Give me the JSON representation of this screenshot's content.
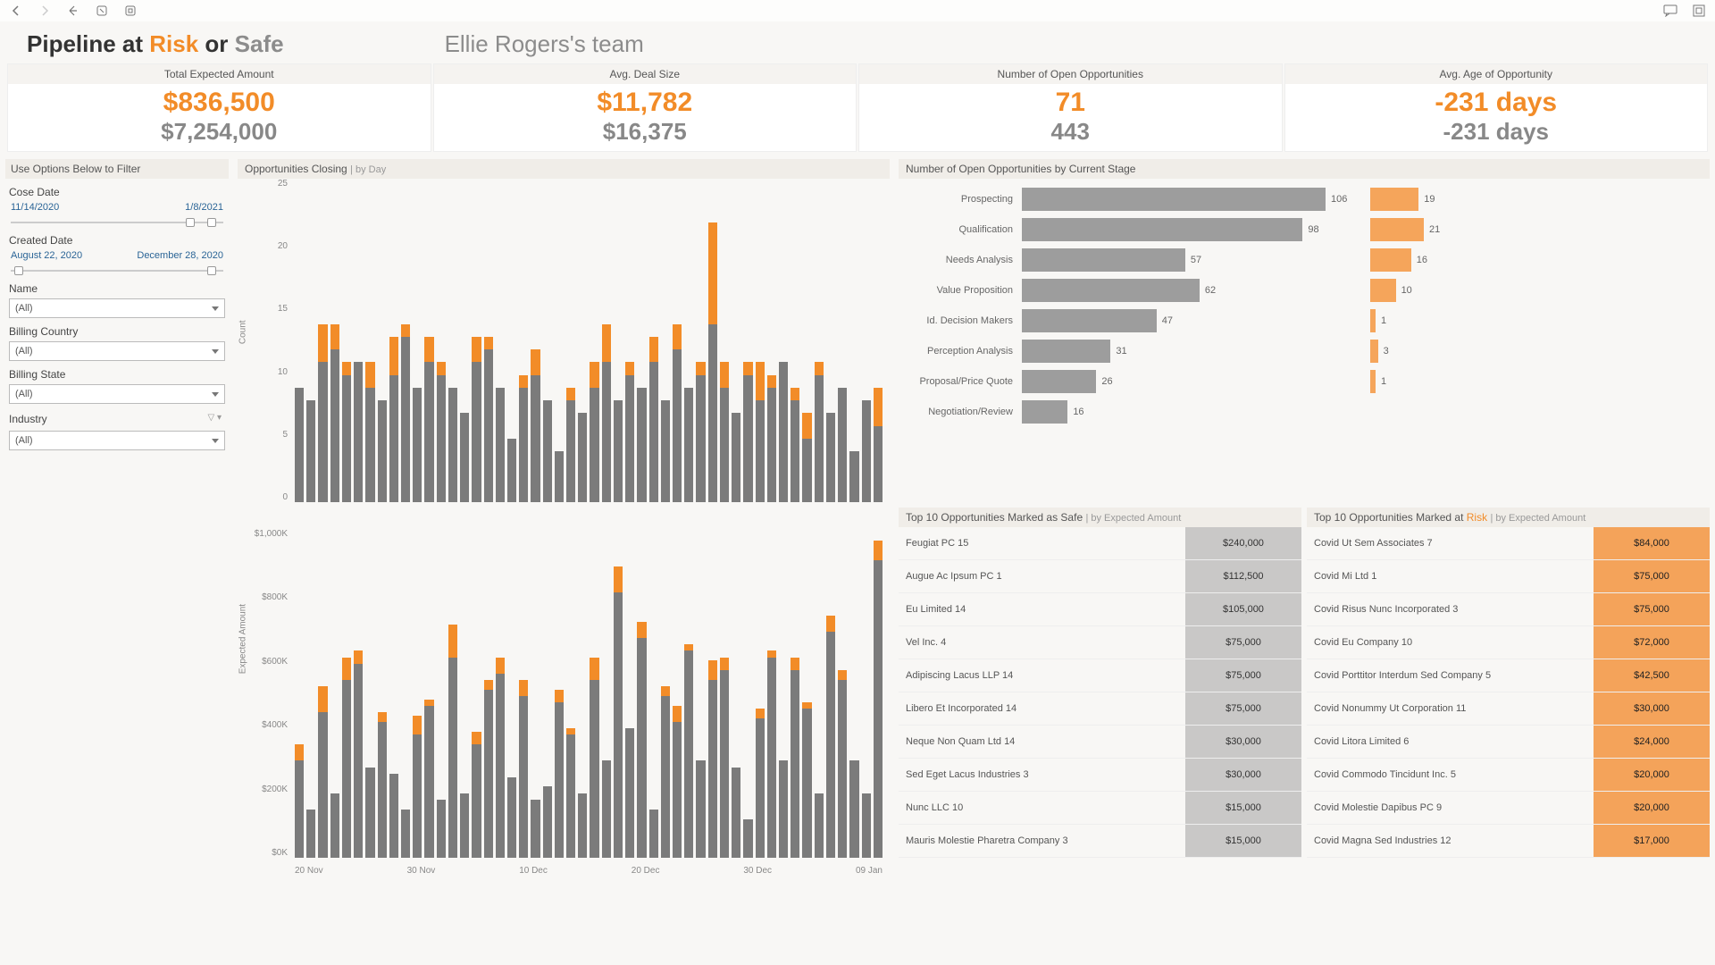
{
  "title": {
    "prefix": "Pipeline at ",
    "risk": "Risk",
    "mid": " or ",
    "safe": "Safe",
    "team": "Ellie Rogers's team"
  },
  "kpis": [
    {
      "label": "Total Expected Amount",
      "v1": "$836,500",
      "v2": "$7,254,000"
    },
    {
      "label": "Avg. Deal Size",
      "v1": "$11,782",
      "v2": "$16,375"
    },
    {
      "label": "Number of Open Opportunities",
      "v1": "71",
      "v2": "443"
    },
    {
      "label": "Avg. Age of Opportunity",
      "v1": "-231 days",
      "v2": "-231 days"
    }
  ],
  "filters": {
    "header": "Use Options Below to Filter",
    "closeDate": {
      "label": "Cose Date",
      "from": "11/14/2020",
      "to": "1/8/2021"
    },
    "createdDate": {
      "label": "Created Date",
      "from": "August 22, 2020",
      "to": "December 28, 2020"
    },
    "name": {
      "label": "Name",
      "value": "(All)"
    },
    "billingCountry": {
      "label": "Billing Country",
      "value": "(All)"
    },
    "billingState": {
      "label": "Billing State",
      "value": "(All)"
    },
    "industry": {
      "label": "Industry",
      "value": "(All)"
    }
  },
  "chart1": {
    "title": "Opportunities Closing ",
    "sub": "| by Day",
    "ylabel": "Count"
  },
  "chart2": {
    "ylabel": "Expected Amount"
  },
  "stages": {
    "title": "Number of Open Opportunities by Current Stage"
  },
  "safeTable": {
    "title": "Top 10 Opportunities Marked as Safe ",
    "sub": "| by Expected Amount"
  },
  "riskTable": {
    "titlePre": "Top 10 Opportunities Marked at ",
    "titleRisk": "Risk ",
    "sub": "| by Expected Amount"
  },
  "chart_data": [
    {
      "type": "bar",
      "title": "Opportunities Closing by Day (Count)",
      "ylabel": "Count",
      "ylim": [
        0,
        25
      ],
      "yticks": [
        0,
        5,
        10,
        15,
        20,
        25
      ],
      "x_ticks": [
        "20 Nov",
        "30 Nov",
        "10 Dec",
        "20 Dec",
        "30 Dec",
        "09 Jan"
      ],
      "series": [
        {
          "name": "Safe",
          "color": "#7b7b7b",
          "values": [
            9,
            8,
            11,
            12,
            10,
            11,
            9,
            8,
            10,
            13,
            9,
            11,
            10,
            9,
            7,
            11,
            12,
            9,
            5,
            9,
            10,
            8,
            4,
            8,
            7,
            9,
            11,
            8,
            10,
            9,
            11,
            8,
            12,
            9,
            10,
            14,
            9,
            7,
            10,
            8,
            9,
            11,
            8,
            5,
            10,
            7,
            9,
            4,
            8,
            6
          ]
        },
        {
          "name": "Risk",
          "color": "#f28c28",
          "values": [
            0,
            0,
            3,
            2,
            1,
            0,
            2,
            0,
            3,
            1,
            0,
            2,
            1,
            0,
            0,
            2,
            1,
            0,
            0,
            1,
            2,
            0,
            0,
            1,
            0,
            2,
            3,
            0,
            1,
            0,
            2,
            0,
            2,
            0,
            1,
            8,
            2,
            0,
            1,
            3,
            1,
            0,
            1,
            2,
            1,
            0,
            0,
            0,
            0,
            3
          ]
        }
      ]
    },
    {
      "type": "bar",
      "title": "Opportunities Closing by Day (Expected Amount $K)",
      "ylabel": "Expected Amount",
      "ylim": [
        0,
        1000
      ],
      "yticks": [
        "$0K",
        "$200K",
        "$400K",
        "$600K",
        "$800K",
        "$1,000K"
      ],
      "x_ticks": [
        "20 Nov",
        "30 Nov",
        "10 Dec",
        "20 Dec",
        "30 Dec",
        "09 Jan"
      ],
      "series": [
        {
          "name": "Safe",
          "color": "#7b7b7b",
          "values": [
            300,
            150,
            450,
            200,
            550,
            600,
            280,
            420,
            260,
            150,
            380,
            470,
            180,
            620,
            200,
            350,
            520,
            570,
            250,
            500,
            180,
            220,
            480,
            380,
            200,
            550,
            300,
            820,
            400,
            680,
            150,
            500,
            420,
            640,
            300,
            550,
            580,
            280,
            120,
            430,
            620,
            300,
            580,
            460,
            200,
            700,
            550,
            300,
            200,
            920
          ]
        },
        {
          "name": "Risk",
          "color": "#f28c28",
          "values": [
            50,
            0,
            80,
            0,
            70,
            40,
            0,
            30,
            0,
            0,
            60,
            20,
            0,
            100,
            0,
            40,
            30,
            50,
            0,
            50,
            0,
            0,
            40,
            20,
            0,
            70,
            0,
            80,
            0,
            50,
            0,
            30,
            50,
            20,
            0,
            60,
            40,
            0,
            0,
            30,
            20,
            0,
            40,
            20,
            0,
            50,
            30,
            0,
            0,
            60
          ]
        }
      ]
    },
    {
      "type": "bar",
      "title": "Number of Open Opportunities by Current Stage",
      "orientation": "horizontal",
      "categories": [
        "Prospecting",
        "Qualification",
        "Needs Analysis",
        "Value Proposition",
        "Id. Decision Makers",
        "Perception Analysis",
        "Proposal/Price Quote",
        "Negotiation/Review"
      ],
      "series": [
        {
          "name": "Safe",
          "color": "#9d9d9d",
          "values": [
            106,
            98,
            57,
            62,
            47,
            31,
            26,
            16
          ]
        },
        {
          "name": "Risk",
          "color": "#f5a55b",
          "values": [
            19,
            21,
            16,
            10,
            1,
            3,
            1,
            0
          ]
        }
      ]
    },
    {
      "type": "table",
      "title": "Top 10 Opportunities Marked as Safe",
      "columns": [
        "Name",
        "Expected Amount"
      ],
      "rows": [
        [
          "Feugiat PC 15",
          "$240,000"
        ],
        [
          "Augue Ac Ipsum PC 1",
          "$112,500"
        ],
        [
          "Eu Limited 14",
          "$105,000"
        ],
        [
          "Vel Inc. 4",
          "$75,000"
        ],
        [
          "Adipiscing Lacus LLP 14",
          "$75,000"
        ],
        [
          "Libero Et Incorporated 14",
          "$75,000"
        ],
        [
          "Neque Non Quam Ltd 14",
          "$30,000"
        ],
        [
          "Sed Eget Lacus Industries 3",
          "$30,000"
        ],
        [
          "Nunc LLC 10",
          "$15,000"
        ],
        [
          "Mauris Molestie Pharetra Company 3",
          "$15,000"
        ]
      ]
    },
    {
      "type": "table",
      "title": "Top 10 Opportunities Marked at Risk",
      "columns": [
        "Name",
        "Expected Amount"
      ],
      "rows": [
        [
          "Covid Ut Sem Associates 7",
          "$84,000"
        ],
        [
          "Covid Mi Ltd 1",
          "$75,000"
        ],
        [
          "Covid Risus Nunc Incorporated 3",
          "$75,000"
        ],
        [
          "Covid Eu Company 10",
          "$72,000"
        ],
        [
          "Covid Porttitor Interdum Sed Company 5",
          "$42,500"
        ],
        [
          "Covid Nonummy Ut Corporation 11",
          "$30,000"
        ],
        [
          "Covid Litora Limited 6",
          "$24,000"
        ],
        [
          "Covid Commodo Tincidunt Inc. 5",
          "$20,000"
        ],
        [
          "Covid Molestie Dapibus PC 9",
          "$20,000"
        ],
        [
          "Covid Magna Sed Industries 12",
          "$17,000"
        ]
      ]
    }
  ]
}
